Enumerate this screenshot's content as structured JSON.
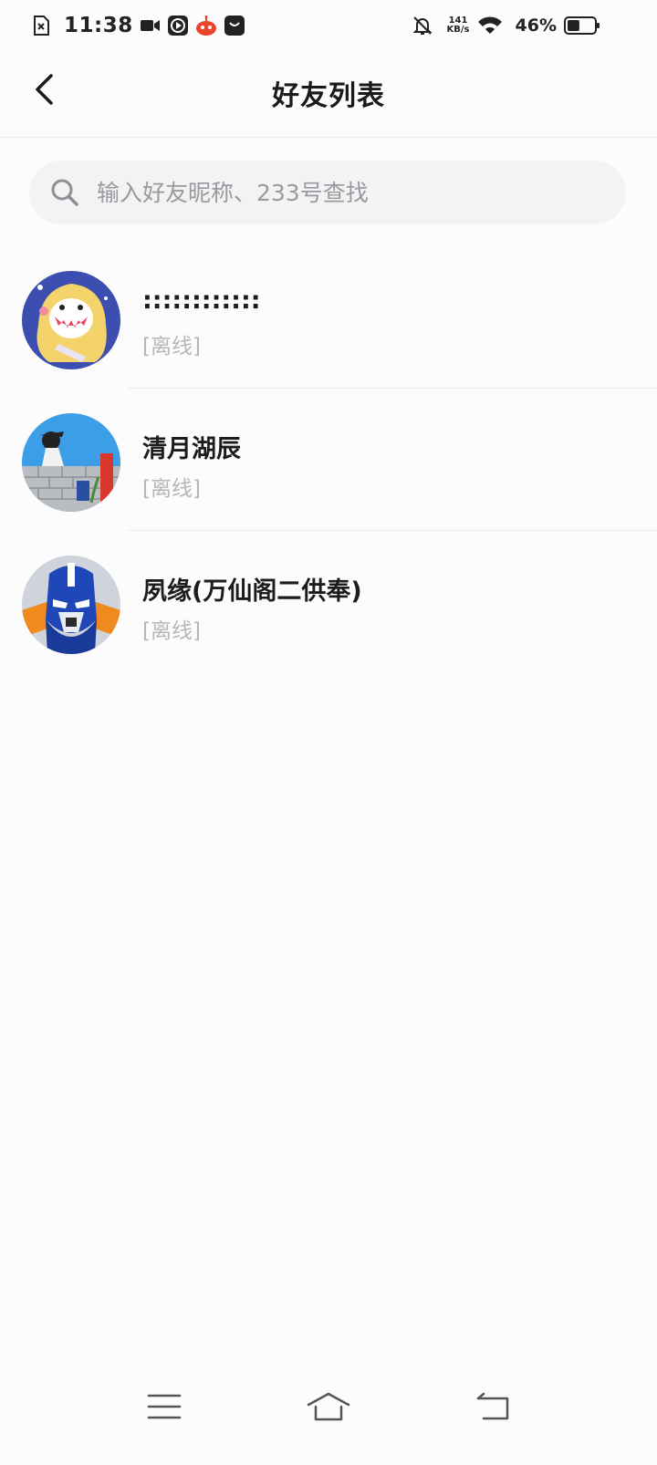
{
  "status_bar": {
    "time": "11:38",
    "net_speed_value": "141",
    "net_speed_unit": "KB/s",
    "battery_percent": "46%",
    "battery_level": 0.46,
    "icons": [
      "sim-missing-icon",
      "video-icon",
      "play-icon",
      "app-icon",
      "bag-icon",
      "bell-off-icon",
      "wifi-icon",
      "battery-icon"
    ]
  },
  "header": {
    "title": "好友列表",
    "back_icon": "chevron-left-icon"
  },
  "search": {
    "placeholder": "输入好友昵称、233号查找",
    "value": "",
    "icon": "search-icon"
  },
  "friends": [
    {
      "name": "::::::::::::",
      "status": "[离线]",
      "avatar": "anime-girl-avatar"
    },
    {
      "name": "清月湖辰",
      "status": "[离线]",
      "avatar": "wall-scene-avatar"
    },
    {
      "name": "夙缘(万仙阁二供奉)",
      "status": "[离线]",
      "avatar": "robot-avatar"
    }
  ],
  "nav_bar": {
    "icons": [
      "menu-icon",
      "home-icon",
      "back-icon"
    ]
  },
  "colors": {
    "background": "#fdfcfd",
    "search_bg": "#f3f2f4",
    "status_text": "#b5b5ba",
    "name_text": "#1c1c1c"
  }
}
